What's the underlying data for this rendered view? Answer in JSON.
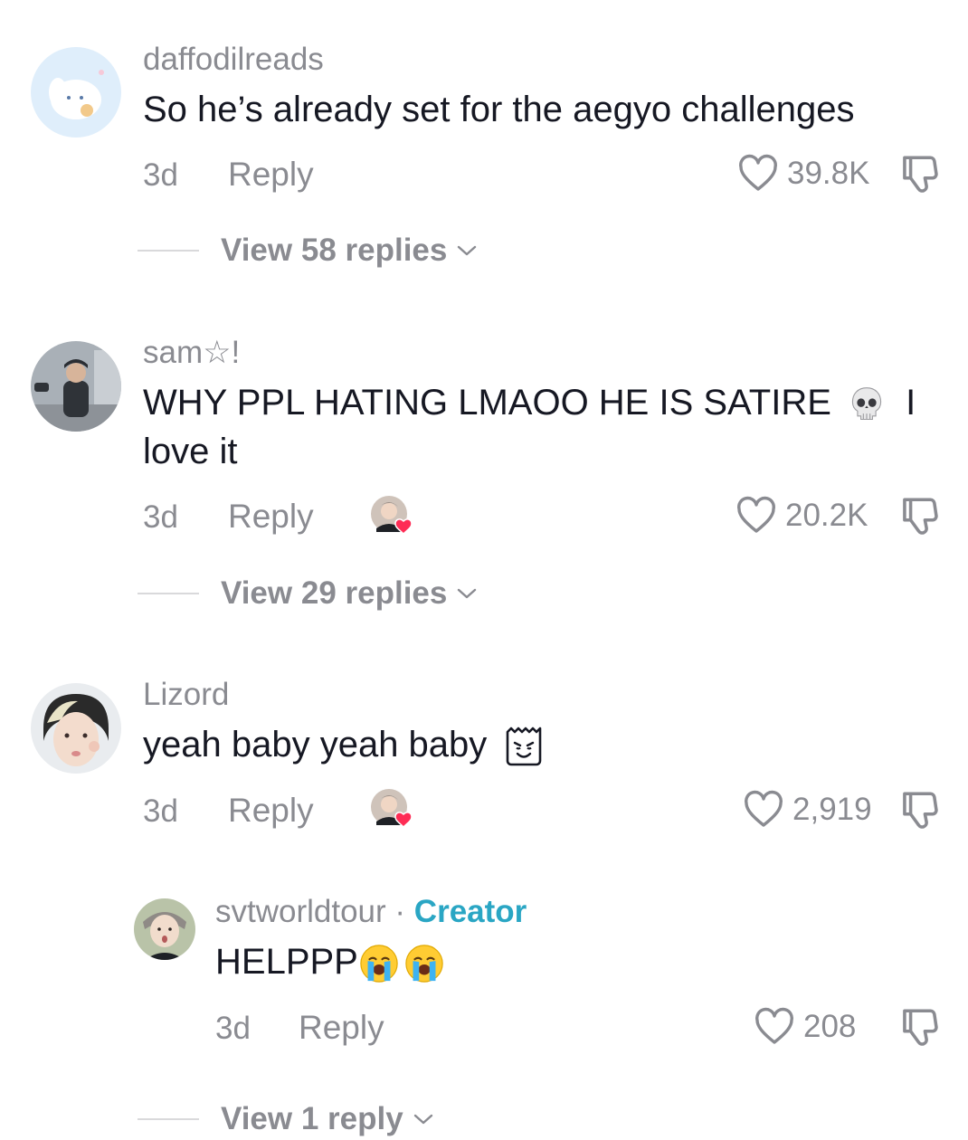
{
  "comments": [
    {
      "username": "daffodilreads",
      "text": "So he’s already set for the aegyo challenges",
      "time": "3d",
      "reply_label": "Reply",
      "likes": "39.8K",
      "view_replies": "View 58 replies",
      "creator_liked": false
    },
    {
      "username": "sam☆!",
      "text_line1": "WHY PPL HATING LMAOO HE IS SATIRE",
      "text_after_emoji": "I",
      "text_line2": "love it",
      "emoji": "skull",
      "time": "3d",
      "reply_label": "Reply",
      "likes": "20.2K",
      "view_replies": "View 29 replies",
      "creator_liked": true
    },
    {
      "username": "Lizord",
      "text": "yeah baby yeah baby",
      "emoji": "smug-bag-face",
      "time": "3d",
      "reply_label": "Reply",
      "likes": "2,919",
      "creator_liked": true
    }
  ],
  "reply": {
    "username": "svtworldtour",
    "separator": "·",
    "badge": "Creator",
    "text": "HELPPP",
    "emojis": [
      "loudly-crying-face",
      "loudly-crying-face"
    ],
    "time": "3d",
    "reply_label": "Reply",
    "likes": "208",
    "view_replies": "View 1 reply"
  },
  "colors": {
    "secondary_text": "#8a8b91",
    "primary_text": "#161823",
    "creator_badge": "#2aa6c4",
    "heart_badge": "#fe2c55"
  }
}
